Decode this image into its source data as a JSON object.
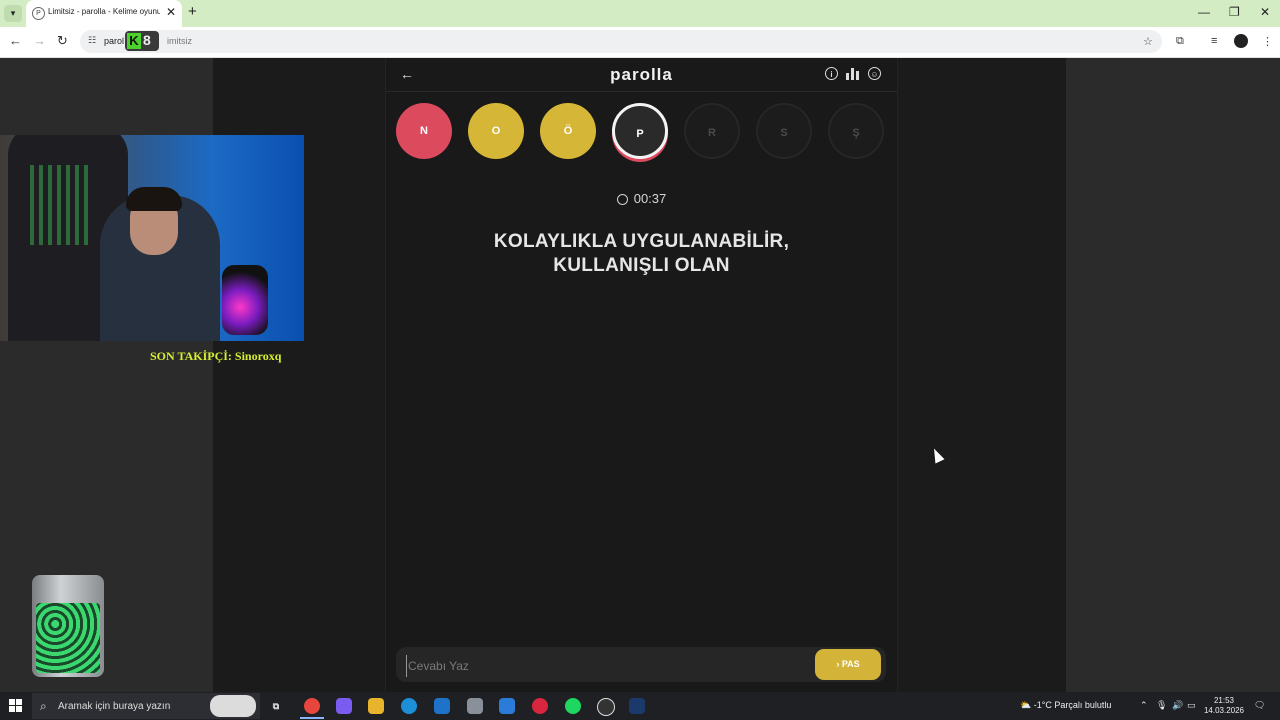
{
  "browser": {
    "tab_title": "Limitsiz - parolla - Kelime oyunu",
    "tab_favicon": "P",
    "url_host": "parol",
    "url_path": "imitsiz",
    "overlay_logo_letters": [
      "K",
      "8"
    ]
  },
  "stream": {
    "follower_text": "SON TAKİPÇİ: Sinoroxq"
  },
  "game": {
    "title": "parolla",
    "letters": [
      {
        "letter": "N",
        "state": "wrong"
      },
      {
        "letter": "O",
        "state": "passed"
      },
      {
        "letter": "Ö",
        "state": "passed"
      },
      {
        "letter": "P",
        "state": "current"
      },
      {
        "letter": "R",
        "state": "idle"
      },
      {
        "letter": "S",
        "state": "idle"
      },
      {
        "letter": "Ş",
        "state": "idle"
      }
    ],
    "timer": "00:37",
    "question_line1": "KOLAYLIKLA UYGULANABİLİR,",
    "question_line2": "KULLANIŞLI OLAN",
    "answer_placeholder": "Cevabı Yaz",
    "pass_label": "PAS",
    "colors": {
      "wrong": "#dc4a5e",
      "passed": "#d6b637",
      "accent_button": "#d4b438"
    }
  },
  "taskbar": {
    "search_placeholder": "Aramak için buraya yazın",
    "weather": "-1°C  Parçalı bulutlu",
    "time": "21:53",
    "date": "14.03.2026"
  }
}
